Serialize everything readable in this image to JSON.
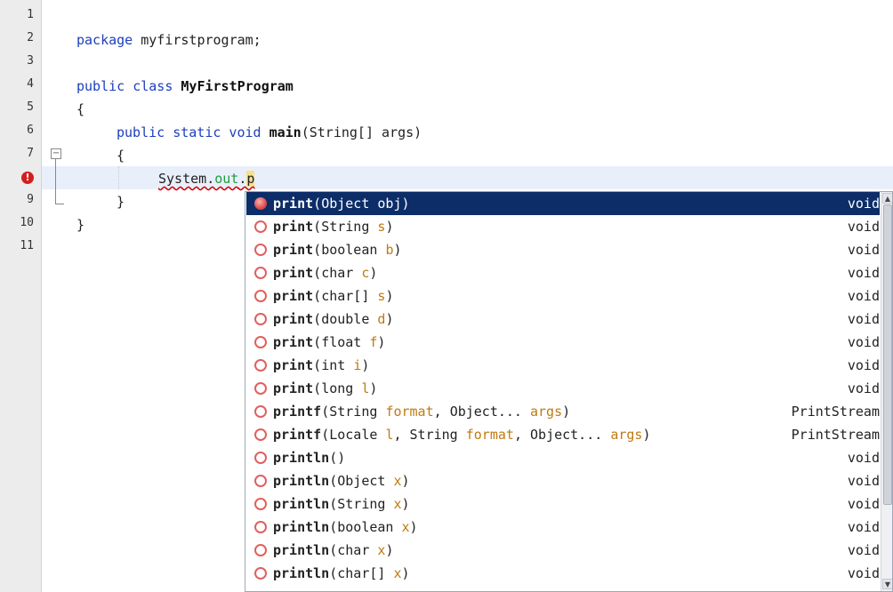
{
  "line_numbers": [
    "1",
    "2",
    "3",
    "4",
    "5",
    "6",
    "7",
    "",
    "9",
    "10",
    "11"
  ],
  "error_marker": "!",
  "fold_toggle": "−",
  "code": {
    "l2_kw": "package",
    "l2_rest": " myfirstprogram;",
    "l4_kw": "public class",
    "l4_space": " ",
    "l4_name": "MyFirstProgram",
    "l5": "{",
    "l6_kw": "public static void",
    "l6_space": " ",
    "l6_name": "main",
    "l6_rest": "(String[] args)",
    "l7": "{",
    "l8_system": "System",
    "l8_dot1": ".",
    "l8_out": "out",
    "l8_dot2": ".",
    "l8_typed": "p",
    "l9": "}",
    "l10": "}"
  },
  "completion": {
    "items": [
      {
        "name": "print",
        "open": "(",
        "params": [
          {
            "type": "Object",
            "name": "obj"
          }
        ],
        "close": ")",
        "ret": "void",
        "selected": true
      },
      {
        "name": "print",
        "open": "(",
        "params": [
          {
            "type": "String",
            "name": "s"
          }
        ],
        "close": ")",
        "ret": "void"
      },
      {
        "name": "print",
        "open": "(",
        "params": [
          {
            "type": "boolean",
            "name": "b"
          }
        ],
        "close": ")",
        "ret": "void"
      },
      {
        "name": "print",
        "open": "(",
        "params": [
          {
            "type": "char",
            "name": "c"
          }
        ],
        "close": ")",
        "ret": "void"
      },
      {
        "name": "print",
        "open": "(",
        "params": [
          {
            "type": "char[]",
            "name": "s"
          }
        ],
        "close": ")",
        "ret": "void"
      },
      {
        "name": "print",
        "open": "(",
        "params": [
          {
            "type": "double",
            "name": "d"
          }
        ],
        "close": ")",
        "ret": "void"
      },
      {
        "name": "print",
        "open": "(",
        "params": [
          {
            "type": "float",
            "name": "f"
          }
        ],
        "close": ")",
        "ret": "void"
      },
      {
        "name": "print",
        "open": "(",
        "params": [
          {
            "type": "int",
            "name": "i"
          }
        ],
        "close": ")",
        "ret": "void"
      },
      {
        "name": "print",
        "open": "(",
        "params": [
          {
            "type": "long",
            "name": "l"
          }
        ],
        "close": ")",
        "ret": "void"
      },
      {
        "name": "printf",
        "open": "(",
        "params": [
          {
            "type": "String",
            "name": "format"
          },
          {
            "type": "Object...",
            "name": "args"
          }
        ],
        "close": ")",
        "ret": "PrintStream"
      },
      {
        "name": "printf",
        "open": "(",
        "params": [
          {
            "type": "Locale",
            "name": "l"
          },
          {
            "type": "String",
            "name": "format"
          },
          {
            "type": "Object...",
            "name": "args"
          }
        ],
        "close": ")",
        "ret": "PrintStream"
      },
      {
        "name": "println",
        "open": "(",
        "params": [],
        "close": ")",
        "ret": "void"
      },
      {
        "name": "println",
        "open": "(",
        "params": [
          {
            "type": "Object",
            "name": "x"
          }
        ],
        "close": ")",
        "ret": "void"
      },
      {
        "name": "println",
        "open": "(",
        "params": [
          {
            "type": "String",
            "name": "x"
          }
        ],
        "close": ")",
        "ret": "void"
      },
      {
        "name": "println",
        "open": "(",
        "params": [
          {
            "type": "boolean",
            "name": "x"
          }
        ],
        "close": ")",
        "ret": "void"
      },
      {
        "name": "println",
        "open": "(",
        "params": [
          {
            "type": "char",
            "name": "x"
          }
        ],
        "close": ")",
        "ret": "void"
      },
      {
        "name": "println",
        "open": "(",
        "params": [
          {
            "type": "char[]",
            "name": "x"
          }
        ],
        "close": ")",
        "ret": "void"
      }
    ],
    "scroll_up": "▲",
    "scroll_down": "▼"
  },
  "colors": {
    "keyword": "#1d3fbb",
    "field": "#1e9e3d",
    "param_name": "#c07a10",
    "selection": "#0c2d68",
    "error": "#d21f1f"
  },
  "icons": {
    "error": "error-icon",
    "method": "method-icon",
    "fold": "fold-toggle-icon"
  }
}
